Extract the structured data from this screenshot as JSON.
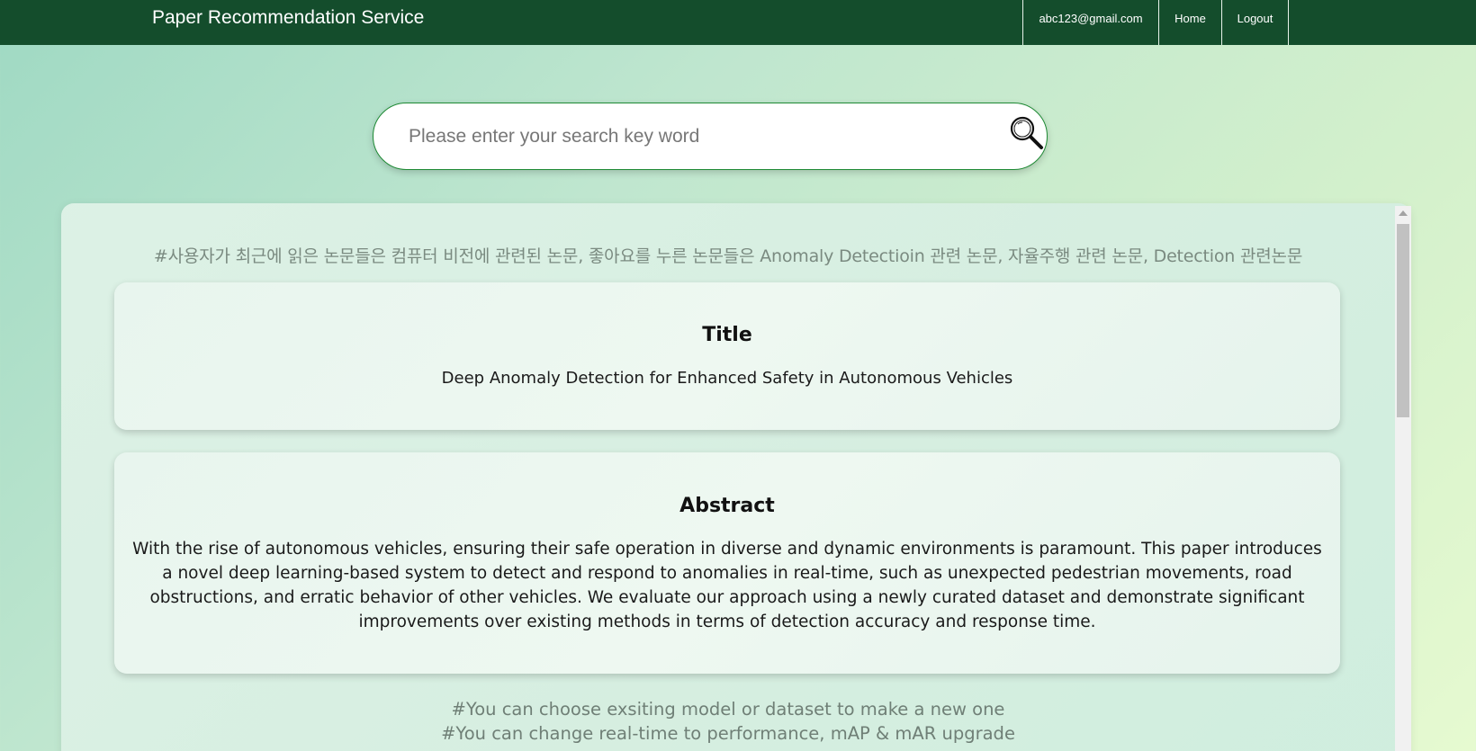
{
  "app": {
    "title": "Paper Recommendation Service"
  },
  "nav": {
    "email": "abc123@gmail.com",
    "home": "Home",
    "logout": "Logout"
  },
  "search": {
    "placeholder": "Please enter your search key word",
    "value": ""
  },
  "profile_summary": "#사용자가 최근에 읽은 논문들은 컴퓨터 비전에 관련된 논문, 좋아요를 누른 논문들은 Anomaly Detectioin 관련 논문, 자율주행 관련 논문, Detection 관련논문",
  "paper": {
    "title_heading": "Title",
    "title": "Deep Anomaly Detection for Enhanced Safety in Autonomous Vehicles",
    "abstract_heading": "Abstract",
    "abstract": "With the rise of autonomous vehicles, ensuring their safe operation in diverse and dynamic environments is paramount. This paper introduces a novel deep learning-based system to detect and respond to anomalies in real-time, such as unexpected pedestrian movements, road obstructions, and erratic behavior of other vehicles. We evaluate our approach using a newly curated dataset and demonstrate significant improvements over existing methods in terms of detection accuracy and response time."
  },
  "notes": [
    "#You can choose exsiting model or dataset to make a new one",
    "#You can change real-time to performance, mAP & mAR upgrade"
  ],
  "colors": {
    "topbar": "#144d2c",
    "search_border": "#1e8a34"
  },
  "icons": {
    "search": "search-icon"
  }
}
